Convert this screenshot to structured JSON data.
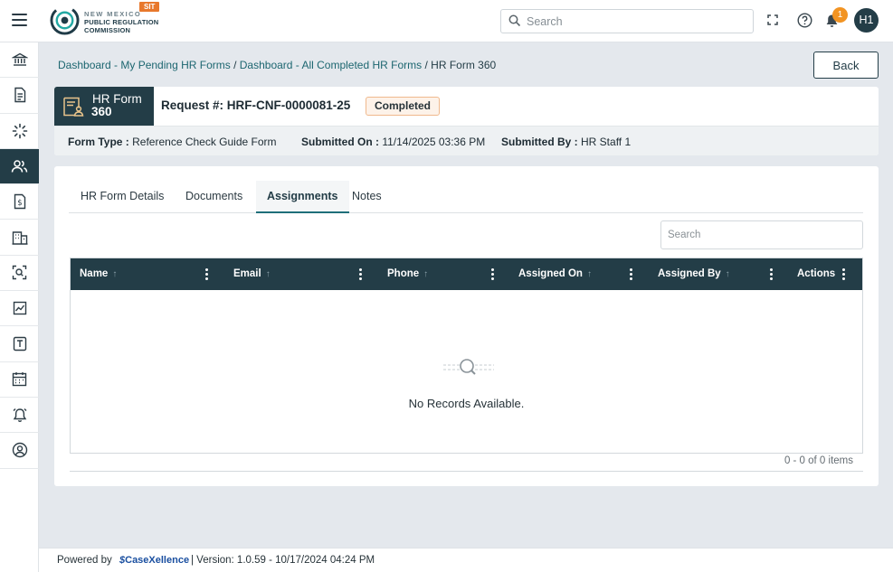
{
  "header": {
    "logo": {
      "line1": "NEW MEXICO",
      "line2": "PUBLIC REGULATION",
      "line3": "COMMISSION",
      "env_badge": "SIT"
    },
    "search_placeholder": "Search",
    "notification_count": "1",
    "avatar_initials": "H1",
    "icons": [
      "hamburger-icon",
      "search-icon",
      "fullscreen-icon",
      "help-icon",
      "bell-icon"
    ]
  },
  "sidebar": {
    "items": [
      {
        "icon": "institution-icon"
      },
      {
        "icon": "document-icon"
      },
      {
        "icon": "loader-icon"
      },
      {
        "icon": "users-icon",
        "active": true
      },
      {
        "icon": "invoice-icon"
      },
      {
        "icon": "building-icon"
      },
      {
        "icon": "scan-search-icon"
      },
      {
        "icon": "chart-icon"
      },
      {
        "icon": "text-box-icon"
      },
      {
        "icon": "calendar-icon"
      },
      {
        "icon": "alarm-icon"
      },
      {
        "icon": "user-circle-icon"
      }
    ]
  },
  "breadcrumb": {
    "items": [
      "Dashboard - My Pending HR Forms",
      "Dashboard - All Completed HR Forms"
    ],
    "current": "HR Form 360"
  },
  "back_label": "Back",
  "form": {
    "chip_line1": "HR Form",
    "chip_line2": "360",
    "request": "Request #: HRF-CNF-0000081-25",
    "status": "Completed",
    "form_type_label": "Form Type :",
    "form_type": "Reference Check Guide Form",
    "submitted_on_label": "Submitted On :",
    "submitted_on": "11/14/2025 03:36 PM",
    "submitted_by_label": "Submitted By :",
    "submitted_by": "HR Staff 1"
  },
  "tabs": [
    "HR Form Details",
    "Documents",
    "Assignments",
    "Notes"
  ],
  "active_tab": "Assignments",
  "grid": {
    "search_placeholder": "Search",
    "columns": [
      "Name",
      "Email",
      "Phone",
      "Assigned On",
      "Assigned By",
      "Actions"
    ],
    "empty_text": "No Records Available.",
    "pager": "0 - 0 of 0 items"
  },
  "footer": {
    "powered_by": "Powered by",
    "brand": "CaseXellence",
    "version": "|   Version: 1.0.59 - 10/17/2024 04:24 PM"
  },
  "colors": {
    "primary_dark": "#233d47",
    "accent_teal": "#1f6f7a",
    "badge_orange": "#e8782c",
    "notification": "#f29423",
    "status_border": "#f0b98d"
  }
}
